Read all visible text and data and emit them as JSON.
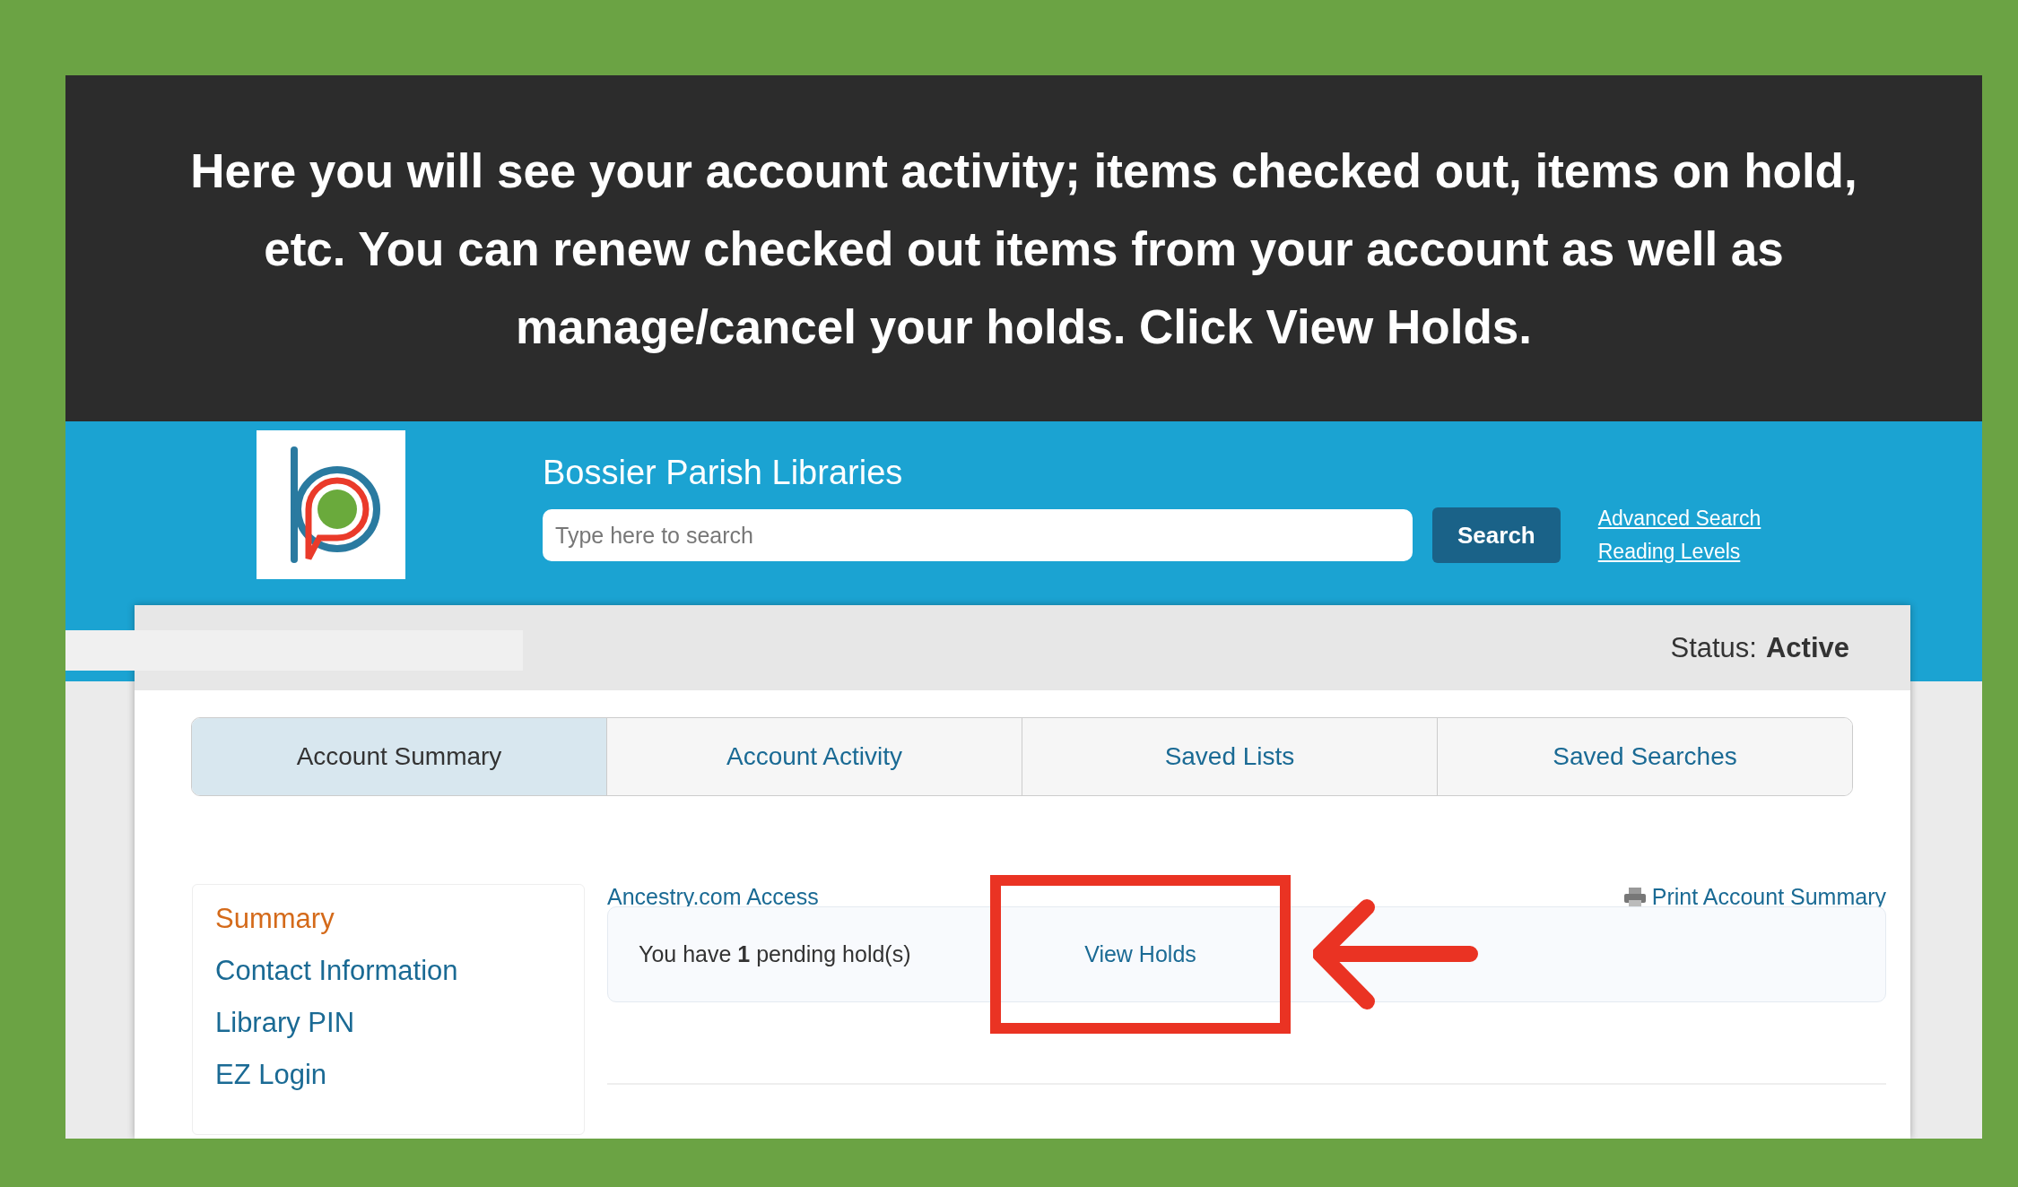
{
  "caption": "Here you will see your account activity; items checked out, items on hold, etc.  You can renew checked out items from your account as well as manage/cancel your holds.  Click View Holds.",
  "header": {
    "title": "Bossier Parish Libraries",
    "search": {
      "placeholder": "Type here to search"
    },
    "search_button": "Search",
    "links": [
      "Advanced Search",
      "Reading Levels"
    ]
  },
  "status": {
    "label": "Status:",
    "value": "Active"
  },
  "tabs": [
    {
      "label": "Account Summary",
      "selected": true
    },
    {
      "label": "Account Activity",
      "selected": false
    },
    {
      "label": "Saved Lists",
      "selected": false
    },
    {
      "label": "Saved Searches",
      "selected": false
    }
  ],
  "sidebar": {
    "items": [
      {
        "label": "Summary",
        "selected": true
      },
      {
        "label": "Contact Information",
        "selected": false
      },
      {
        "label": "Library PIN",
        "selected": false
      },
      {
        "label": "EZ Login",
        "selected": false
      }
    ]
  },
  "content": {
    "ancestry_link": "Ancestry.com Access",
    "print_link": "Print Account Summary",
    "holds_text": "You have **1** pending hold(s)",
    "holds_link": "View Holds",
    "highlighted": true
  }
}
